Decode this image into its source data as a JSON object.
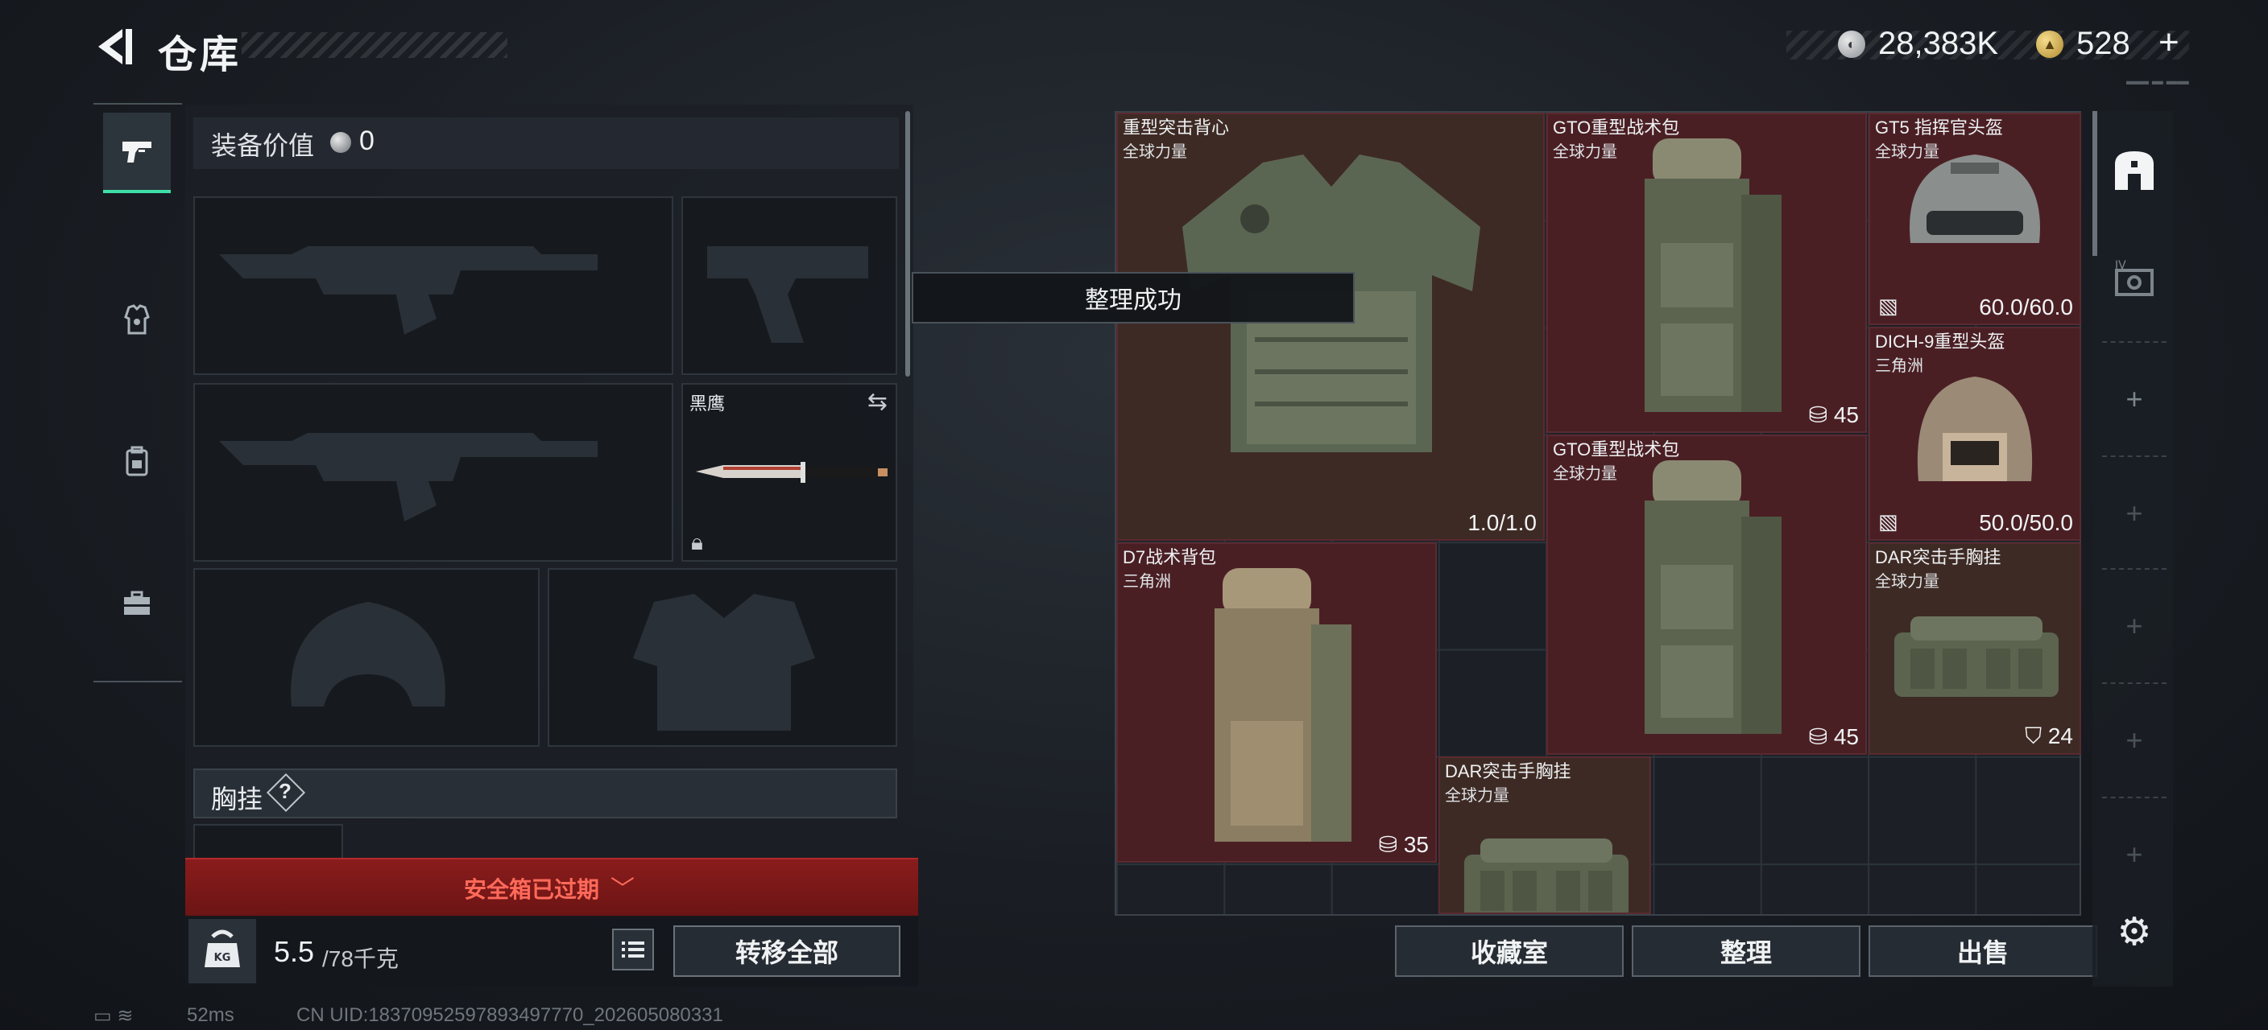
{
  "header": {
    "title": "仓库",
    "silver_coin_value": "28,383K",
    "gold_coin_value": "528",
    "add_coin_label": "+",
    "corner_text": "IV"
  },
  "equipment": {
    "value_label": "装备价值",
    "value": "0",
    "knife_name": "黑鹰",
    "chest_rig_label": "胸挂",
    "chest_rig_help": "?",
    "safebox_text": "安全箱已过期",
    "weight_current": "5.5",
    "weight_max": "/78千克",
    "weight_icon_text": "KG",
    "transfer_all_label": "转移全部"
  },
  "storage": {
    "toast": "整理成功",
    "items": [
      {
        "name": "重型突击背心",
        "sub": "全球力量",
        "stat": "1.0/1.0"
      },
      {
        "name": "GTO重型战术包",
        "sub": "全球力量",
        "stat": "45"
      },
      {
        "name": "GT5 指挥官头盔",
        "sub": "全球力量",
        "stat": "60.0/60.0"
      },
      {
        "name": "DICH-9重型头盔",
        "sub": "三角洲",
        "stat": "50.0/50.0"
      },
      {
        "name": "GTO重型战术包",
        "sub": "全球力量",
        "stat": "45"
      },
      {
        "name": "D7战术背包",
        "sub": "三角洲",
        "stat": "35"
      },
      {
        "name": "DAR突击手胸挂",
        "sub": "全球力量",
        "stat": "24"
      },
      {
        "name": "DAR突击手胸挂",
        "sub": "全球力量",
        "stat": ""
      }
    ],
    "collection_label": "收藏室",
    "tidy_label": "整理",
    "sell_label": "出售"
  },
  "status": {
    "ping": "52ms",
    "uid": "CN UID:18370952597893497770_202605080331"
  },
  "colors": {
    "accent": "#3fe0a8",
    "item_bg": "#4a1f24",
    "safebox_red": "#8a1c1c",
    "panel_bg": "#1c2026"
  }
}
